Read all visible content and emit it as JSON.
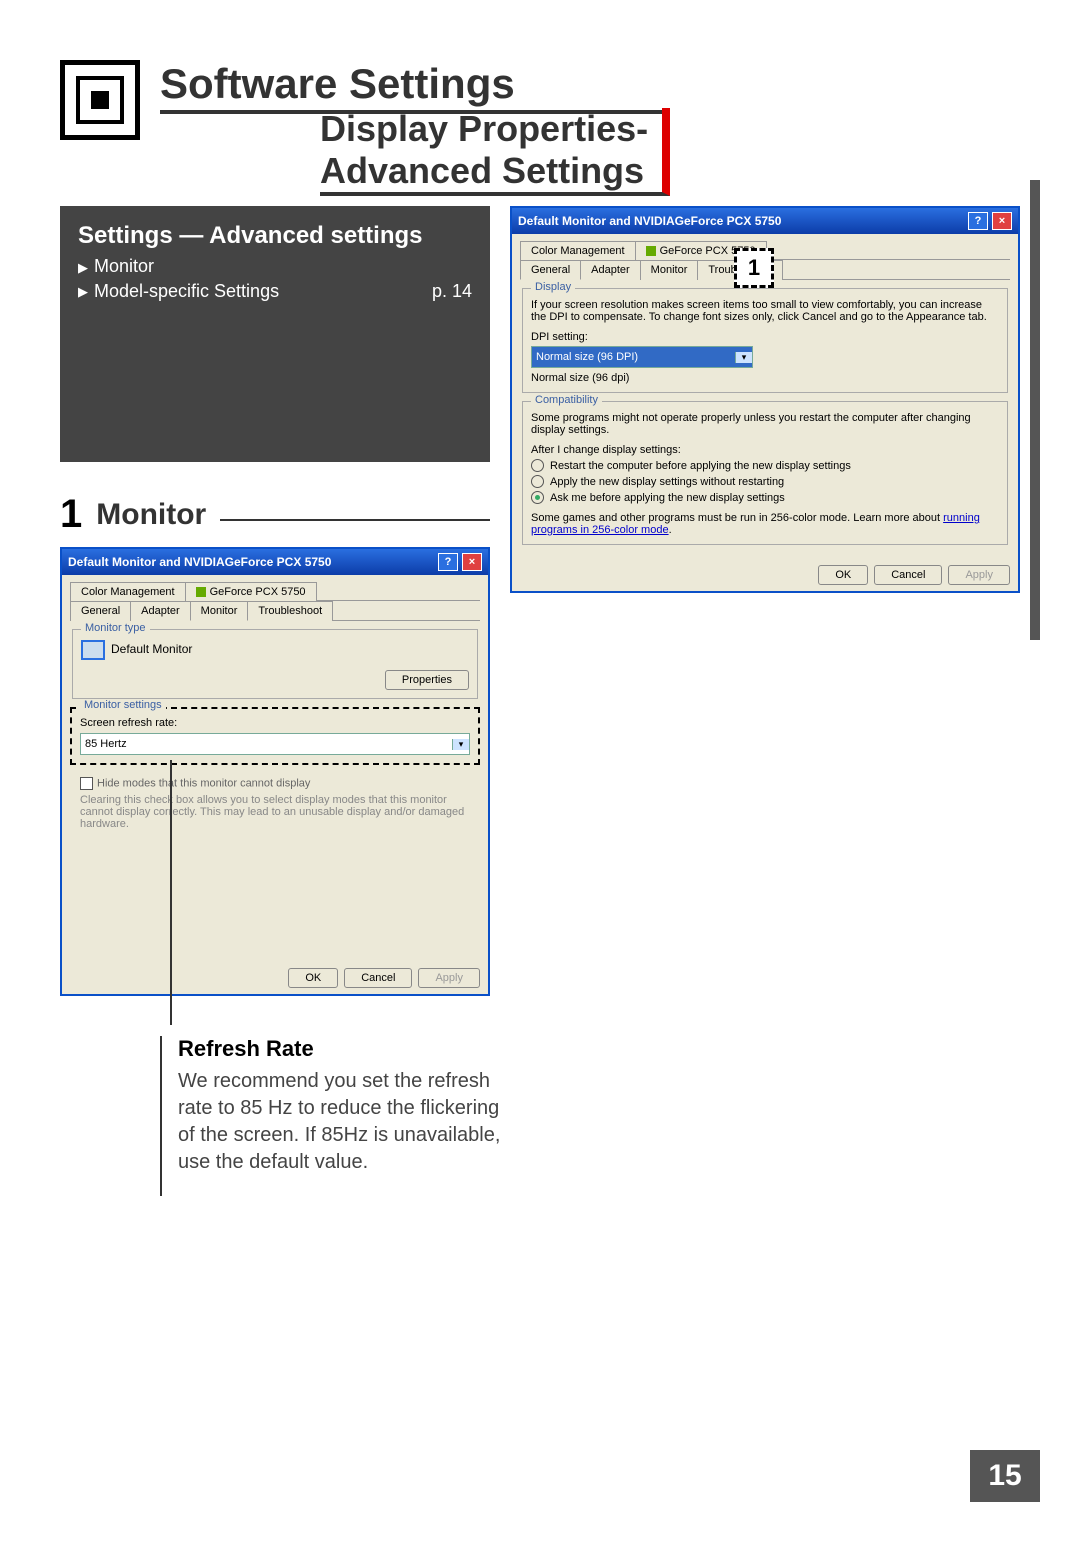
{
  "header": {
    "software_settings": "Software Settings",
    "display_properties": "Display Properties-",
    "advanced_settings": "Advanced Settings"
  },
  "gray": {
    "title": "Settings — Advanced settings",
    "monitor": "Monitor",
    "model_specific": "Model-specific Settings",
    "page_ref": "p. 14"
  },
  "section1": {
    "num": "1",
    "label": "Monitor"
  },
  "xp_right": {
    "title": "Default Monitor and NVIDIAGeForce PCX 5750",
    "tabs_top": [
      "Color Management",
      "GeForce PCX 5750"
    ],
    "tabs_bottom": [
      "General",
      "Adapter",
      "Monitor",
      "Troubleshoot"
    ],
    "display_group": "Display",
    "display_desc": "If your screen resolution makes screen items too small to view comfortably, you can increase the DPI to compensate. To change font sizes only, click Cancel and go to the Appearance tab.",
    "dpi_label": "DPI setting:",
    "dpi_value": "Normal size (96 DPI)",
    "dpi_note": "Normal size (96 dpi)",
    "compat_group": "Compatibility",
    "compat_desc": "Some programs might not operate properly unless you restart the computer after changing display settings.",
    "compat_after": "After I change display settings:",
    "radio1": "Restart the computer before applying the new display settings",
    "radio2": "Apply the new display settings without restarting",
    "radio3": "Ask me before applying the new display settings",
    "compat_games": "Some games and other programs must be run in 256-color mode. Learn more about",
    "compat_link": "running programs in 256-color mode",
    "ok": "OK",
    "cancel": "Cancel",
    "apply": "Apply"
  },
  "xp_left": {
    "title": "Default Monitor and NVIDIAGeForce PCX 5750",
    "tabs_top": [
      "Color Management",
      "GeForce PCX 5750"
    ],
    "tabs_bottom": [
      "General",
      "Adapter",
      "Monitor",
      "Troubleshoot"
    ],
    "mon_type_group": "Monitor type",
    "mon_name": "Default Monitor",
    "properties": "Properties",
    "mon_settings_group": "Monitor settings",
    "refresh_label": "Screen refresh rate:",
    "refresh_value": "85 Hertz",
    "hide_modes": "Hide modes that this monitor cannot display",
    "hide_desc": "Clearing this check box allows you to select display modes that this monitor cannot display correctly. This may lead to an unusable display and/or damaged hardware.",
    "ok": "OK",
    "cancel": "Cancel",
    "apply": "Apply"
  },
  "callout": {
    "one": "1"
  },
  "refresh": {
    "title": "Refresh Rate",
    "desc": "We recommend you set the refresh rate to 85 Hz to reduce the flickering of the screen. If 85Hz is unavailable, use the default value."
  },
  "page_number": "15"
}
